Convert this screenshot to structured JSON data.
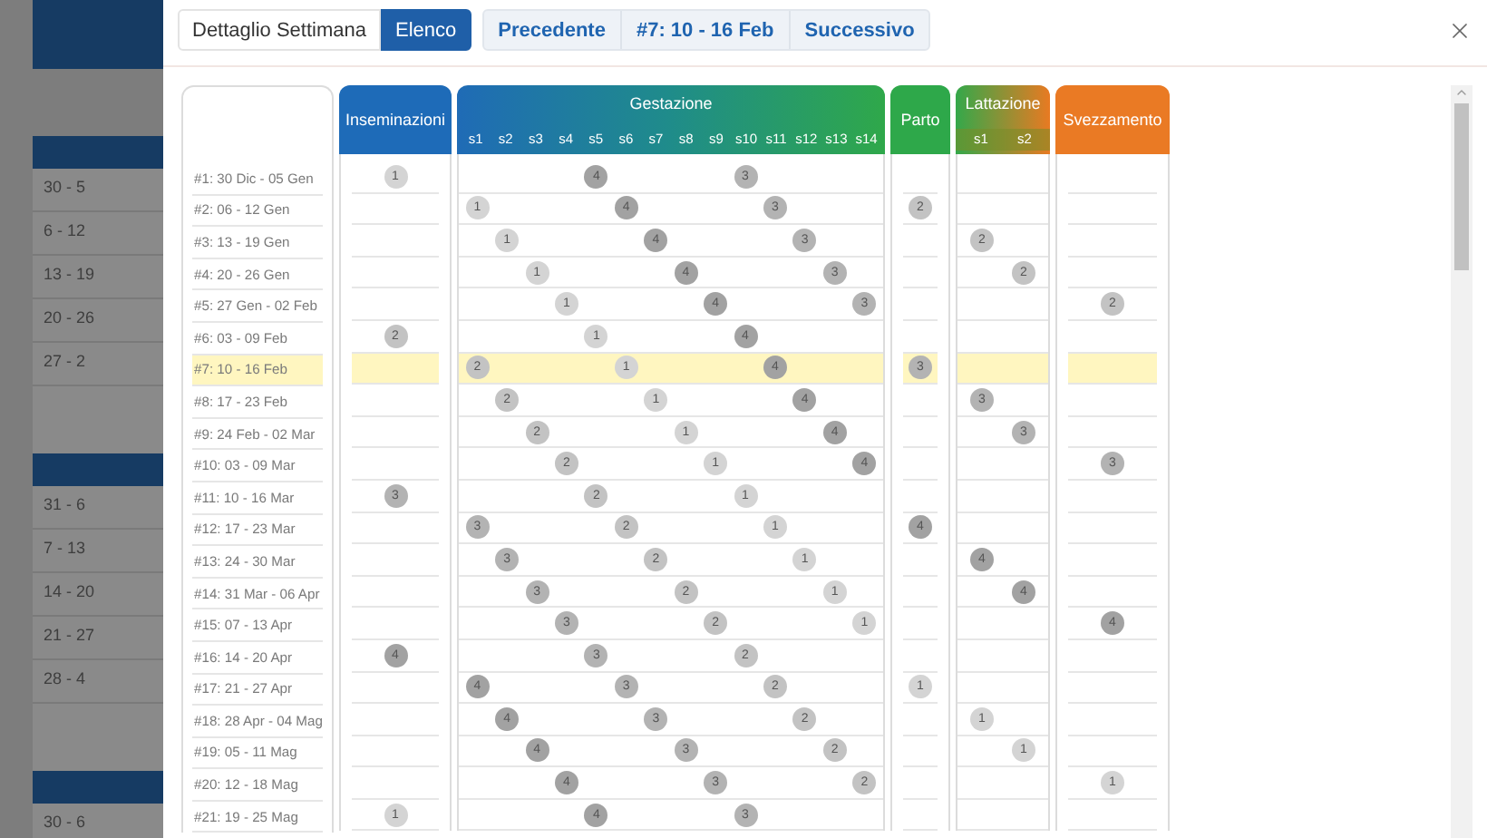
{
  "background": {
    "groups": [
      {
        "rows": [
          "30 - 5",
          "6 - 12",
          "13 - 19",
          "20 - 26",
          "27 - 2"
        ]
      },
      {
        "rows": [
          "31 - 6",
          "7 - 13",
          "14 - 20",
          "21 - 27",
          "28 - 4"
        ]
      },
      {
        "rows": [
          "30 - 6"
        ]
      }
    ]
  },
  "toolbar": {
    "views": [
      {
        "label": "Dettaglio Settimana",
        "selected": false
      },
      {
        "label": "Elenco",
        "selected": true
      }
    ],
    "nav": [
      "Precedente",
      "#7: 10 - 16 Feb",
      "Successivo"
    ]
  },
  "columns": {
    "inseminazioni": "Inseminazioni",
    "gestazione": {
      "title": "Gestazione",
      "weeks": [
        "s1",
        "s2",
        "s3",
        "s4",
        "s5",
        "s6",
        "s7",
        "s8",
        "s9",
        "s10",
        "s11",
        "s12",
        "s13",
        "s14"
      ]
    },
    "parto": "Parto",
    "lattazione": {
      "title": "Lattazione",
      "weeks": [
        "s1",
        "s2"
      ]
    },
    "svezzamento": "Svezzamento"
  },
  "rows": [
    {
      "label": "#1: 30 Dic - 05 Gen",
      "selected": false,
      "inseminazioni": {
        "label": "1",
        "color": "#d4d4d4"
      },
      "gestazione": [
        {
          "kind": "blank"
        },
        {
          "kind": "blank"
        },
        {
          "kind": "blank"
        },
        {
          "kind": "blank"
        },
        {
          "kind": "dot",
          "label": "4",
          "color": "#a2a2a2"
        },
        {
          "kind": "blank"
        },
        {
          "kind": "blank"
        },
        {
          "kind": "blank"
        },
        {
          "kind": "blank"
        },
        {
          "kind": "dot",
          "label": "3",
          "color": "#b3b3b3"
        },
        {
          "kind": "blank"
        },
        {
          "kind": "blank"
        },
        {
          "kind": "blank"
        },
        {
          "kind": "blank"
        }
      ],
      "lattazione": [
        {
          "kind": "blank"
        },
        {
          "kind": "blank"
        }
      ]
    },
    {
      "label": "#2: 06 - 12 Gen",
      "selected": false,
      "gestazione": [
        {
          "kind": "dot",
          "label": "1",
          "color": "#d4d4d4"
        },
        {
          "kind": "blank"
        },
        {
          "kind": "blank"
        },
        {
          "kind": "blank"
        },
        {
          "kind": "blank"
        },
        {
          "kind": "dot",
          "label": "4",
          "color": "#a2a2a2"
        },
        {
          "kind": "blank"
        },
        {
          "kind": "blank"
        },
        {
          "kind": "blank"
        },
        {
          "kind": "blank"
        },
        {
          "kind": "dot",
          "label": "3",
          "color": "#b3b3b3"
        },
        {
          "kind": "blank"
        },
        {
          "kind": "blank"
        },
        {
          "kind": "blank"
        }
      ],
      "parto": {
        "label": "2",
        "color": "#c3c3c3"
      },
      "lattazione": [
        {
          "kind": "blank"
        },
        {
          "kind": "blank"
        }
      ]
    },
    {
      "label": "#3: 13 - 19 Gen",
      "selected": false,
      "gestazione": [
        {
          "kind": "blank"
        },
        {
          "kind": "dot",
          "label": "1",
          "color": "#d4d4d4"
        },
        {
          "kind": "blank"
        },
        {
          "kind": "blank"
        },
        {
          "kind": "blank"
        },
        {
          "kind": "blank"
        },
        {
          "kind": "dot",
          "label": "4",
          "color": "#a2a2a2"
        },
        {
          "kind": "blank"
        },
        {
          "kind": "blank"
        },
        {
          "kind": "blank"
        },
        {
          "kind": "blank"
        },
        {
          "kind": "dot",
          "label": "3",
          "color": "#b3b3b3"
        },
        {
          "kind": "blank"
        },
        {
          "kind": "blank"
        }
      ],
      "lattazione": [
        {
          "kind": "dot",
          "label": "2",
          "color": "#c3c3c3"
        },
        {
          "kind": "blank"
        }
      ]
    },
    {
      "label": "#4: 20 - 26 Gen",
      "selected": false,
      "gestazione": [
        {
          "kind": "blank"
        },
        {
          "kind": "blank"
        },
        {
          "kind": "dot",
          "label": "1",
          "color": "#d4d4d4"
        },
        {
          "kind": "blank"
        },
        {
          "kind": "blank"
        },
        {
          "kind": "blank"
        },
        {
          "kind": "blank"
        },
        {
          "kind": "dot",
          "label": "4",
          "color": "#a2a2a2"
        },
        {
          "kind": "blank"
        },
        {
          "kind": "blank"
        },
        {
          "kind": "blank"
        },
        {
          "kind": "blank"
        },
        {
          "kind": "dot",
          "label": "3",
          "color": "#b3b3b3"
        },
        {
          "kind": "blank"
        }
      ],
      "lattazione": [
        {
          "kind": "blank"
        },
        {
          "kind": "dot",
          "label": "2",
          "color": "#c3c3c3"
        }
      ]
    },
    {
      "label": "#5: 27 Gen - 02 Feb",
      "selected": false,
      "gestazione": [
        {
          "kind": "blank"
        },
        {
          "kind": "blank"
        },
        {
          "kind": "blank"
        },
        {
          "kind": "dot",
          "label": "1",
          "color": "#d4d4d4"
        },
        {
          "kind": "blank"
        },
        {
          "kind": "blank"
        },
        {
          "kind": "blank"
        },
        {
          "kind": "blank"
        },
        {
          "kind": "dot",
          "label": "4",
          "color": "#a2a2a2"
        },
        {
          "kind": "blank"
        },
        {
          "kind": "blank"
        },
        {
          "kind": "blank"
        },
        {
          "kind": "blank"
        },
        {
          "kind": "dot",
          "label": "3",
          "color": "#b3b3b3"
        }
      ],
      "lattazione": [
        {
          "kind": "blank"
        },
        {
          "kind": "blank"
        }
      ],
      "svezzamento": {
        "label": "2",
        "color": "#c3c3c3"
      }
    },
    {
      "label": "#6: 03 - 09 Feb",
      "selected": false,
      "inseminazioni": {
        "label": "2",
        "color": "#c3c3c3"
      },
      "gestazione": [
        {
          "kind": "blank"
        },
        {
          "kind": "blank"
        },
        {
          "kind": "blank"
        },
        {
          "kind": "blank"
        },
        {
          "kind": "dot",
          "label": "1",
          "color": "#d4d4d4"
        },
        {
          "kind": "blank"
        },
        {
          "kind": "blank"
        },
        {
          "kind": "blank"
        },
        {
          "kind": "blank"
        },
        {
          "kind": "dot",
          "label": "4",
          "color": "#a2a2a2"
        },
        {
          "kind": "blank"
        },
        {
          "kind": "blank"
        },
        {
          "kind": "blank"
        },
        {
          "kind": "blank"
        }
      ],
      "lattazione": [
        {
          "kind": "blank"
        },
        {
          "kind": "blank"
        }
      ]
    },
    {
      "label": "#7: 10 - 16 Feb",
      "selected": true,
      "gestazione": [
        {
          "kind": "dot",
          "label": "2",
          "color": "#c3c3c3"
        },
        {
          "kind": "blank"
        },
        {
          "kind": "blank"
        },
        {
          "kind": "blank"
        },
        {
          "kind": "blank"
        },
        {
          "kind": "dot",
          "label": "1",
          "color": "#d4d4d4"
        },
        {
          "kind": "blank"
        },
        {
          "kind": "blank"
        },
        {
          "kind": "blank"
        },
        {
          "kind": "blank"
        },
        {
          "kind": "dot",
          "label": "4",
          "color": "#a2a2a2"
        },
        {
          "kind": "blank"
        },
        {
          "kind": "blank"
        },
        {
          "kind": "blank"
        }
      ],
      "parto": {
        "label": "3",
        "color": "#b3b3b3"
      },
      "lattazione": [
        {
          "kind": "blank"
        },
        {
          "kind": "blank"
        }
      ]
    },
    {
      "label": "#8: 17 - 23 Feb",
      "selected": false,
      "gestazione": [
        {
          "kind": "blank"
        },
        {
          "kind": "dot",
          "label": "2",
          "color": "#c3c3c3"
        },
        {
          "kind": "blank"
        },
        {
          "kind": "blank"
        },
        {
          "kind": "blank"
        },
        {
          "kind": "blank"
        },
        {
          "kind": "dot",
          "label": "1",
          "color": "#d4d4d4"
        },
        {
          "kind": "blank"
        },
        {
          "kind": "blank"
        },
        {
          "kind": "blank"
        },
        {
          "kind": "blank"
        },
        {
          "kind": "dot",
          "label": "4",
          "color": "#a2a2a2"
        },
        {
          "kind": "blank"
        },
        {
          "kind": "blank"
        }
      ],
      "lattazione": [
        {
          "kind": "dot",
          "label": "3",
          "color": "#b3b3b3"
        },
        {
          "kind": "blank"
        }
      ]
    },
    {
      "label": "#9: 24 Feb - 02 Mar",
      "selected": false,
      "gestazione": [
        {
          "kind": "blank"
        },
        {
          "kind": "blank"
        },
        {
          "kind": "dot",
          "label": "2",
          "color": "#c3c3c3"
        },
        {
          "kind": "blank"
        },
        {
          "kind": "blank"
        },
        {
          "kind": "blank"
        },
        {
          "kind": "blank"
        },
        {
          "kind": "dot",
          "label": "1",
          "color": "#d4d4d4"
        },
        {
          "kind": "blank"
        },
        {
          "kind": "blank"
        },
        {
          "kind": "blank"
        },
        {
          "kind": "blank"
        },
        {
          "kind": "dot",
          "label": "4",
          "color": "#a2a2a2"
        },
        {
          "kind": "blank"
        }
      ],
      "lattazione": [
        {
          "kind": "blank"
        },
        {
          "kind": "dot",
          "label": "3",
          "color": "#b3b3b3"
        }
      ]
    },
    {
      "label": "#10: 03 - 09 Mar",
      "selected": false,
      "gestazione": [
        {
          "kind": "blank"
        },
        {
          "kind": "blank"
        },
        {
          "kind": "blank"
        },
        {
          "kind": "dot",
          "label": "2",
          "color": "#c3c3c3"
        },
        {
          "kind": "blank"
        },
        {
          "kind": "blank"
        },
        {
          "kind": "blank"
        },
        {
          "kind": "blank"
        },
        {
          "kind": "dot",
          "label": "1",
          "color": "#d4d4d4"
        },
        {
          "kind": "blank"
        },
        {
          "kind": "blank"
        },
        {
          "kind": "blank"
        },
        {
          "kind": "blank"
        },
        {
          "kind": "dot",
          "label": "4",
          "color": "#a2a2a2"
        }
      ],
      "lattazione": [
        {
          "kind": "blank"
        },
        {
          "kind": "blank"
        }
      ],
      "svezzamento": {
        "label": "3",
        "color": "#b3b3b3"
      }
    },
    {
      "label": "#11: 10 - 16 Mar",
      "selected": false,
      "inseminazioni": {
        "label": "3",
        "color": "#b3b3b3"
      },
      "gestazione": [
        {
          "kind": "blank"
        },
        {
          "kind": "blank"
        },
        {
          "kind": "blank"
        },
        {
          "kind": "blank"
        },
        {
          "kind": "dot",
          "label": "2",
          "color": "#c3c3c3"
        },
        {
          "kind": "blank"
        },
        {
          "kind": "blank"
        },
        {
          "kind": "blank"
        },
        {
          "kind": "blank"
        },
        {
          "kind": "dot",
          "label": "1",
          "color": "#d4d4d4"
        },
        {
          "kind": "blank"
        },
        {
          "kind": "blank"
        },
        {
          "kind": "blank"
        },
        {
          "kind": "blank"
        }
      ],
      "lattazione": [
        {
          "kind": "blank"
        },
        {
          "kind": "blank"
        }
      ]
    },
    {
      "label": "#12: 17 - 23 Mar",
      "selected": false,
      "gestazione": [
        {
          "kind": "dot",
          "label": "3",
          "color": "#b3b3b3"
        },
        {
          "kind": "blank"
        },
        {
          "kind": "blank"
        },
        {
          "kind": "blank"
        },
        {
          "kind": "blank"
        },
        {
          "kind": "dot",
          "label": "2",
          "color": "#c3c3c3"
        },
        {
          "kind": "blank"
        },
        {
          "kind": "blank"
        },
        {
          "kind": "blank"
        },
        {
          "kind": "blank"
        },
        {
          "kind": "dot",
          "label": "1",
          "color": "#d4d4d4"
        },
        {
          "kind": "blank"
        },
        {
          "kind": "blank"
        },
        {
          "kind": "blank"
        }
      ],
      "parto": {
        "label": "4",
        "color": "#a2a2a2"
      },
      "lattazione": [
        {
          "kind": "blank"
        },
        {
          "kind": "blank"
        }
      ]
    },
    {
      "label": "#13: 24 - 30 Mar",
      "selected": false,
      "gestazione": [
        {
          "kind": "blank"
        },
        {
          "kind": "dot",
          "label": "3",
          "color": "#b3b3b3"
        },
        {
          "kind": "blank"
        },
        {
          "kind": "blank"
        },
        {
          "kind": "blank"
        },
        {
          "kind": "blank"
        },
        {
          "kind": "dot",
          "label": "2",
          "color": "#c3c3c3"
        },
        {
          "kind": "blank"
        },
        {
          "kind": "blank"
        },
        {
          "kind": "blank"
        },
        {
          "kind": "blank"
        },
        {
          "kind": "dot",
          "label": "1",
          "color": "#d4d4d4"
        },
        {
          "kind": "blank"
        },
        {
          "kind": "blank"
        }
      ],
      "lattazione": [
        {
          "kind": "dot",
          "label": "4",
          "color": "#a2a2a2"
        },
        {
          "kind": "blank"
        }
      ]
    },
    {
      "label": "#14: 31 Mar - 06 Apr",
      "selected": false,
      "gestazione": [
        {
          "kind": "blank"
        },
        {
          "kind": "blank"
        },
        {
          "kind": "dot",
          "label": "3",
          "color": "#b3b3b3"
        },
        {
          "kind": "blank"
        },
        {
          "kind": "blank"
        },
        {
          "kind": "blank"
        },
        {
          "kind": "blank"
        },
        {
          "kind": "dot",
          "label": "2",
          "color": "#c3c3c3"
        },
        {
          "kind": "blank"
        },
        {
          "kind": "blank"
        },
        {
          "kind": "blank"
        },
        {
          "kind": "blank"
        },
        {
          "kind": "dot",
          "label": "1",
          "color": "#d4d4d4"
        },
        {
          "kind": "blank"
        }
      ],
      "lattazione": [
        {
          "kind": "blank"
        },
        {
          "kind": "dot",
          "label": "4",
          "color": "#a2a2a2"
        }
      ]
    },
    {
      "label": "#15: 07 - 13 Apr",
      "selected": false,
      "gestazione": [
        {
          "kind": "blank"
        },
        {
          "kind": "blank"
        },
        {
          "kind": "blank"
        },
        {
          "kind": "dot",
          "label": "3",
          "color": "#b3b3b3"
        },
        {
          "kind": "blank"
        },
        {
          "kind": "blank"
        },
        {
          "kind": "blank"
        },
        {
          "kind": "blank"
        },
        {
          "kind": "dot",
          "label": "2",
          "color": "#c3c3c3"
        },
        {
          "kind": "blank"
        },
        {
          "kind": "blank"
        },
        {
          "kind": "blank"
        },
        {
          "kind": "blank"
        },
        {
          "kind": "dot",
          "label": "1",
          "color": "#d4d4d4"
        }
      ],
      "lattazione": [
        {
          "kind": "blank"
        },
        {
          "kind": "blank"
        }
      ],
      "svezzamento": {
        "label": "4",
        "color": "#a2a2a2"
      }
    },
    {
      "label": "#16: 14 - 20 Apr",
      "selected": false,
      "inseminazioni": {
        "label": "4",
        "color": "#a2a2a2"
      },
      "gestazione": [
        {
          "kind": "blank"
        },
        {
          "kind": "blank"
        },
        {
          "kind": "blank"
        },
        {
          "kind": "blank"
        },
        {
          "kind": "dot",
          "label": "3",
          "color": "#b3b3b3"
        },
        {
          "kind": "blank"
        },
        {
          "kind": "blank"
        },
        {
          "kind": "blank"
        },
        {
          "kind": "blank"
        },
        {
          "kind": "dot",
          "label": "2",
          "color": "#c3c3c3"
        },
        {
          "kind": "blank"
        },
        {
          "kind": "blank"
        },
        {
          "kind": "blank"
        },
        {
          "kind": "blank"
        }
      ],
      "lattazione": [
        {
          "kind": "blank"
        },
        {
          "kind": "blank"
        }
      ]
    },
    {
      "label": "#17: 21 - 27 Apr",
      "selected": false,
      "gestazione": [
        {
          "kind": "dot",
          "label": "4",
          "color": "#a2a2a2"
        },
        {
          "kind": "blank"
        },
        {
          "kind": "blank"
        },
        {
          "kind": "blank"
        },
        {
          "kind": "blank"
        },
        {
          "kind": "dot",
          "label": "3",
          "color": "#b3b3b3"
        },
        {
          "kind": "blank"
        },
        {
          "kind": "blank"
        },
        {
          "kind": "blank"
        },
        {
          "kind": "blank"
        },
        {
          "kind": "dot",
          "label": "2",
          "color": "#c3c3c3"
        },
        {
          "kind": "blank"
        },
        {
          "kind": "blank"
        },
        {
          "kind": "blank"
        }
      ],
      "parto": {
        "label": "1",
        "color": "#d4d4d4"
      },
      "lattazione": [
        {
          "kind": "blank"
        },
        {
          "kind": "blank"
        }
      ]
    },
    {
      "label": "#18: 28 Apr - 04 Mag",
      "selected": false,
      "gestazione": [
        {
          "kind": "blank"
        },
        {
          "kind": "dot",
          "label": "4",
          "color": "#a2a2a2"
        },
        {
          "kind": "blank"
        },
        {
          "kind": "blank"
        },
        {
          "kind": "blank"
        },
        {
          "kind": "blank"
        },
        {
          "kind": "dot",
          "label": "3",
          "color": "#b3b3b3"
        },
        {
          "kind": "blank"
        },
        {
          "kind": "blank"
        },
        {
          "kind": "blank"
        },
        {
          "kind": "blank"
        },
        {
          "kind": "dot",
          "label": "2",
          "color": "#c3c3c3"
        },
        {
          "kind": "blank"
        },
        {
          "kind": "blank"
        }
      ],
      "lattazione": [
        {
          "kind": "dot",
          "label": "1",
          "color": "#d4d4d4"
        },
        {
          "kind": "blank"
        }
      ]
    },
    {
      "label": "#19: 05 - 11 Mag",
      "selected": false,
      "gestazione": [
        {
          "kind": "blank"
        },
        {
          "kind": "blank"
        },
        {
          "kind": "dot",
          "label": "4",
          "color": "#a2a2a2"
        },
        {
          "kind": "blank"
        },
        {
          "kind": "blank"
        },
        {
          "kind": "blank"
        },
        {
          "kind": "blank"
        },
        {
          "kind": "dot",
          "label": "3",
          "color": "#b3b3b3"
        },
        {
          "kind": "blank"
        },
        {
          "kind": "blank"
        },
        {
          "kind": "blank"
        },
        {
          "kind": "blank"
        },
        {
          "kind": "dot",
          "label": "2",
          "color": "#c3c3c3"
        },
        {
          "kind": "blank"
        }
      ],
      "lattazione": [
        {
          "kind": "blank"
        },
        {
          "kind": "dot",
          "label": "1",
          "color": "#d4d4d4"
        }
      ]
    },
    {
      "label": "#20: 12 - 18 Mag",
      "selected": false,
      "gestazione": [
        {
          "kind": "blank"
        },
        {
          "kind": "blank"
        },
        {
          "kind": "blank"
        },
        {
          "kind": "dot",
          "label": "4",
          "color": "#a2a2a2"
        },
        {
          "kind": "blank"
        },
        {
          "kind": "blank"
        },
        {
          "kind": "blank"
        },
        {
          "kind": "blank"
        },
        {
          "kind": "dot",
          "label": "3",
          "color": "#b3b3b3"
        },
        {
          "kind": "blank"
        },
        {
          "kind": "blank"
        },
        {
          "kind": "blank"
        },
        {
          "kind": "blank"
        },
        {
          "kind": "dot",
          "label": "2",
          "color": "#c3c3c3"
        }
      ],
      "lattazione": [
        {
          "kind": "blank"
        },
        {
          "kind": "blank"
        }
      ],
      "svezzamento": {
        "label": "1",
        "color": "#d4d4d4"
      }
    },
    {
      "label": "#21: 19 - 25 Mag",
      "selected": false,
      "inseminazioni": {
        "label": "1",
        "color": "#d4d4d4"
      },
      "gestazione": [
        {
          "kind": "blank"
        },
        {
          "kind": "blank"
        },
        {
          "kind": "blank"
        },
        {
          "kind": "blank"
        },
        {
          "kind": "dot",
          "label": "4",
          "color": "#a2a2a2"
        },
        {
          "kind": "blank"
        },
        {
          "kind": "blank"
        },
        {
          "kind": "blank"
        },
        {
          "kind": "blank"
        },
        {
          "kind": "dot",
          "label": "3",
          "color": "#b3b3b3"
        },
        {
          "kind": "blank"
        },
        {
          "kind": "blank"
        },
        {
          "kind": "blank"
        },
        {
          "kind": "blank"
        }
      ],
      "lattazione": [
        {
          "kind": "blank"
        },
        {
          "kind": "blank"
        }
      ]
    }
  ]
}
